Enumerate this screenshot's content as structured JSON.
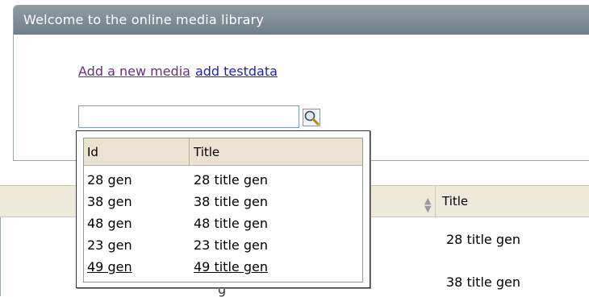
{
  "panel": {
    "title": "Welcome to the online media library"
  },
  "links": {
    "add_media": "Add a new media",
    "add_testdata": "add testdata"
  },
  "search": {
    "value": "",
    "placeholder": ""
  },
  "table": {
    "title_header": "Title",
    "rows": [
      {
        "title": "28 title gen"
      },
      {
        "title": "38 title gen"
      }
    ]
  },
  "autocomplete": {
    "headers": {
      "id": "Id",
      "title": "Title"
    },
    "rows": [
      {
        "id": "28 gen",
        "title": "28 title gen"
      },
      {
        "id": "38 gen",
        "title": "38 title gen"
      },
      {
        "id": "48 gen",
        "title": "48 title gen"
      },
      {
        "id": "23 gen",
        "title": "23 title gen"
      },
      {
        "id": "49 gen",
        "title": "49 title gen"
      }
    ]
  },
  "icons": {
    "search_button": "magnifier-icon",
    "sort": "sort-arrows-icon"
  },
  "colors": {
    "header": "#7c8b91",
    "visited_link": "#6a2e86",
    "link": "#1a1ad8",
    "table_header": "#efe9d9"
  }
}
